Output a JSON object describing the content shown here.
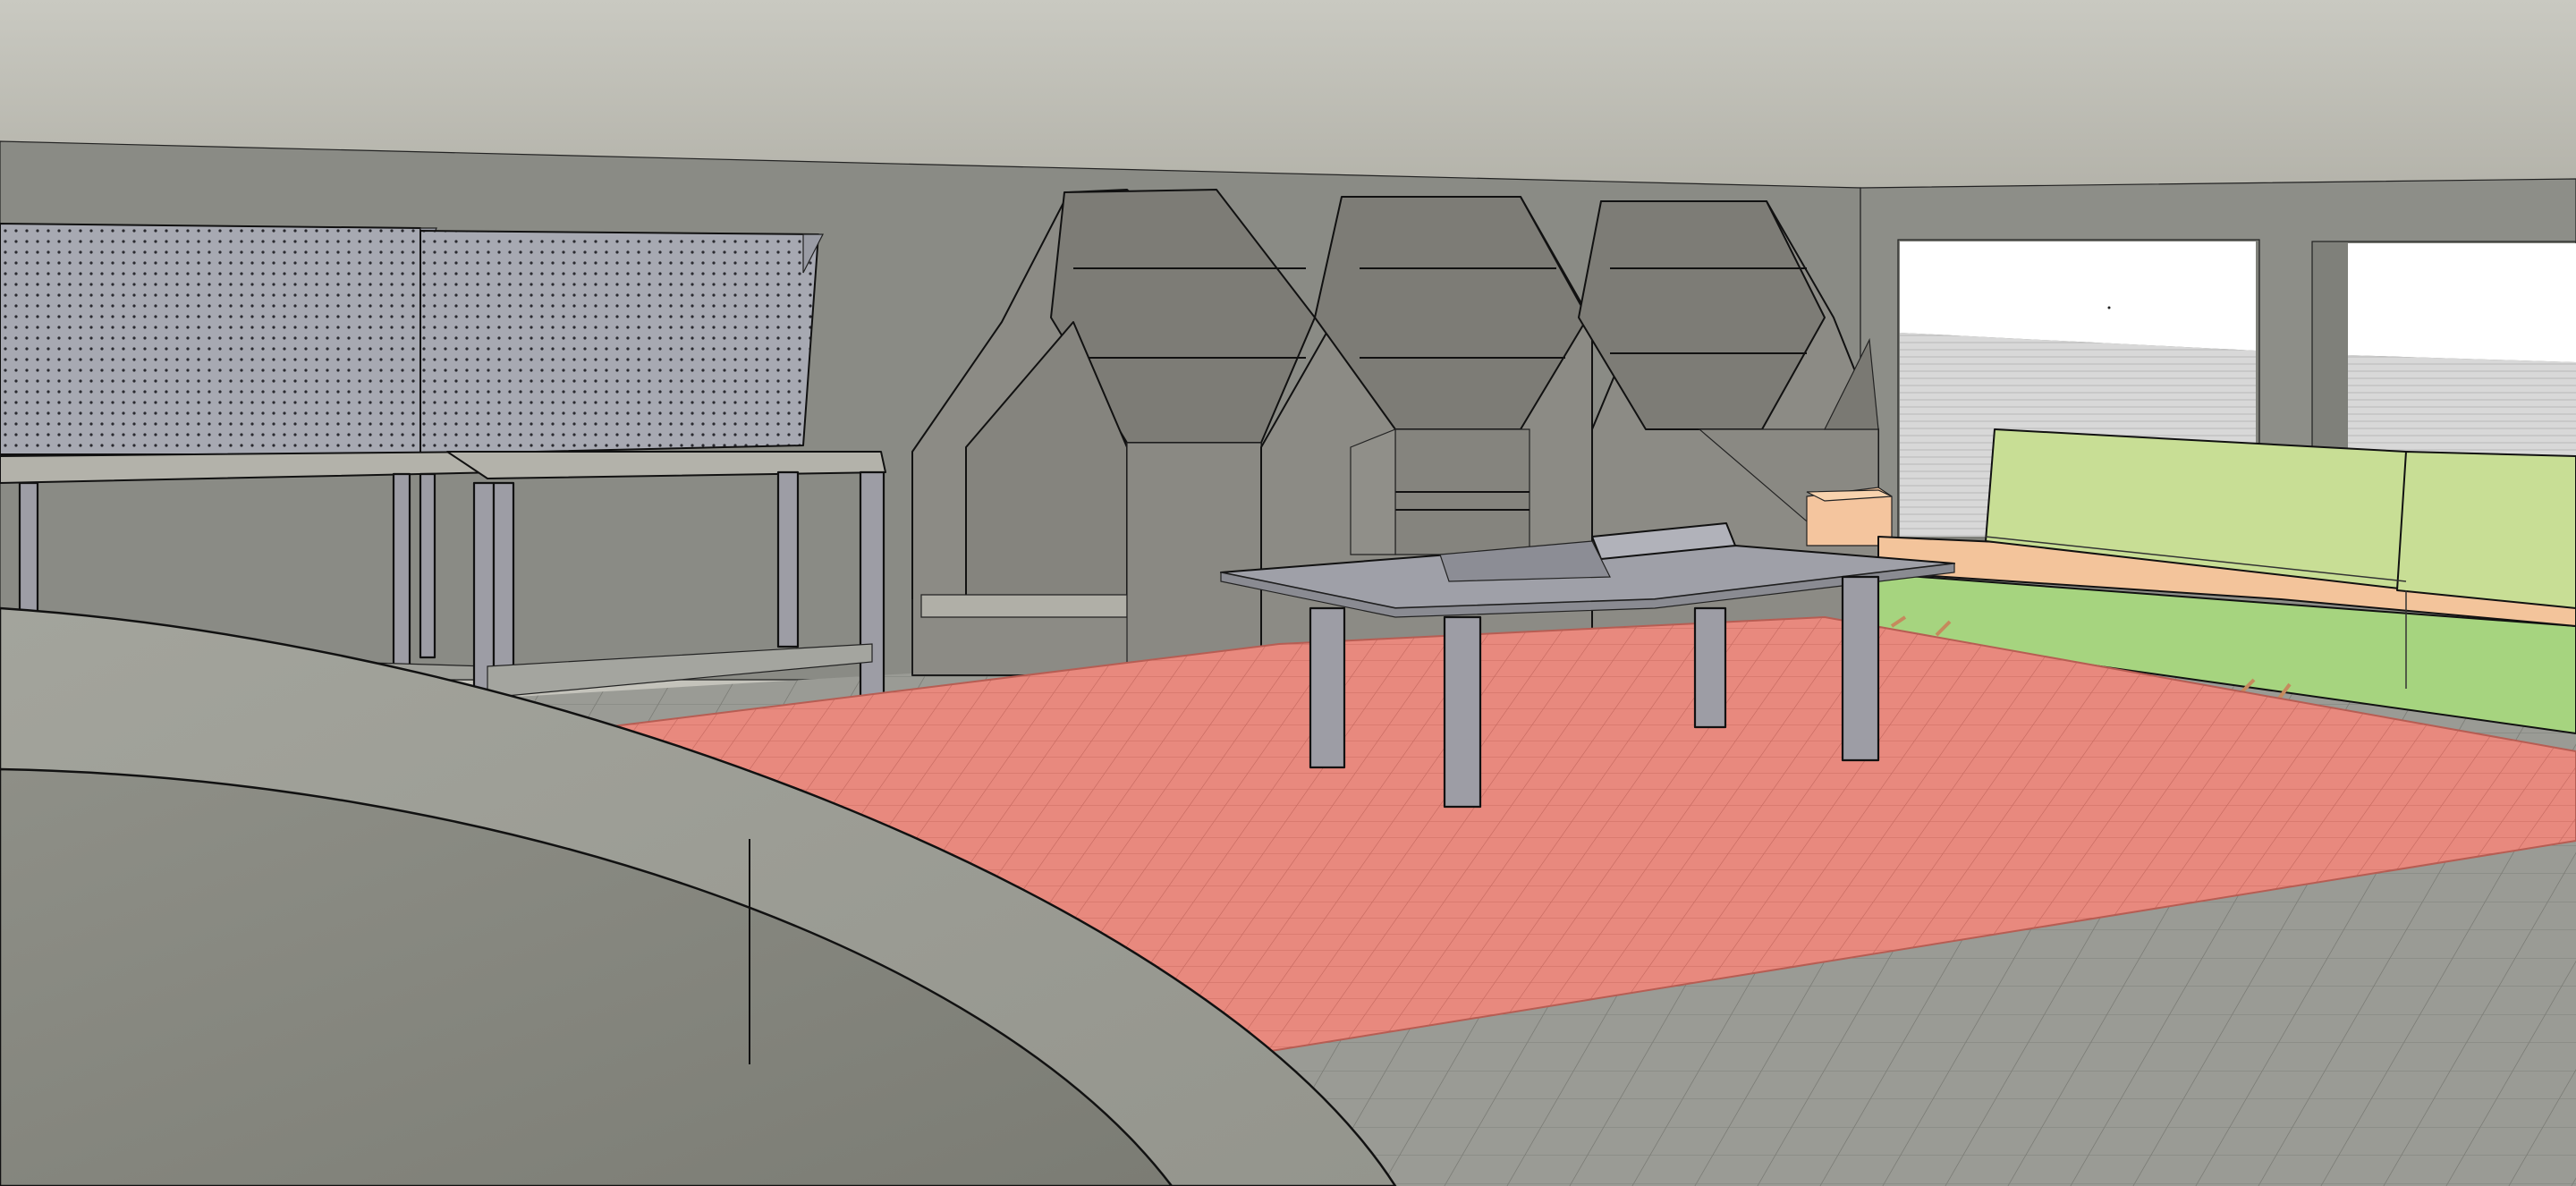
{
  "scene": {
    "colors": {
      "ceiling": "#c4c3bb",
      "back_wall": "#8a8b85",
      "right_wall": "#8d8e88",
      "floor": "#969791",
      "rug": "#e8897e",
      "sofa_green": "#c8de95",
      "sofa_peach": "#f3c49b",
      "metal": "#9d9da5",
      "pegboard": "#a7a9b2",
      "shelf": "#8c8b85",
      "curved_wall": "#94958d",
      "window_glass": "#ffffff"
    },
    "objects": [
      {
        "name": "ceiling",
        "kind": "surface"
      },
      {
        "name": "back-wall",
        "kind": "surface"
      },
      {
        "name": "right-wall",
        "kind": "surface"
      },
      {
        "name": "floor",
        "kind": "surface"
      },
      {
        "name": "window-left",
        "kind": "window"
      },
      {
        "name": "window-right",
        "kind": "window"
      },
      {
        "name": "workbench-left",
        "kind": "furniture"
      },
      {
        "name": "workbench-right",
        "kind": "furniture"
      },
      {
        "name": "pegboard-left",
        "kind": "furniture"
      },
      {
        "name": "pegboard-right",
        "kind": "furniture"
      },
      {
        "name": "house-shelf-1",
        "kind": "furniture"
      },
      {
        "name": "house-shelf-2",
        "kind": "furniture"
      },
      {
        "name": "house-shelf-3",
        "kind": "furniture"
      },
      {
        "name": "rug",
        "kind": "decor"
      },
      {
        "name": "extendable-table",
        "kind": "furniture"
      },
      {
        "name": "side-table",
        "kind": "furniture"
      },
      {
        "name": "sofa",
        "kind": "furniture"
      },
      {
        "name": "curved-wall",
        "kind": "surface"
      }
    ]
  }
}
